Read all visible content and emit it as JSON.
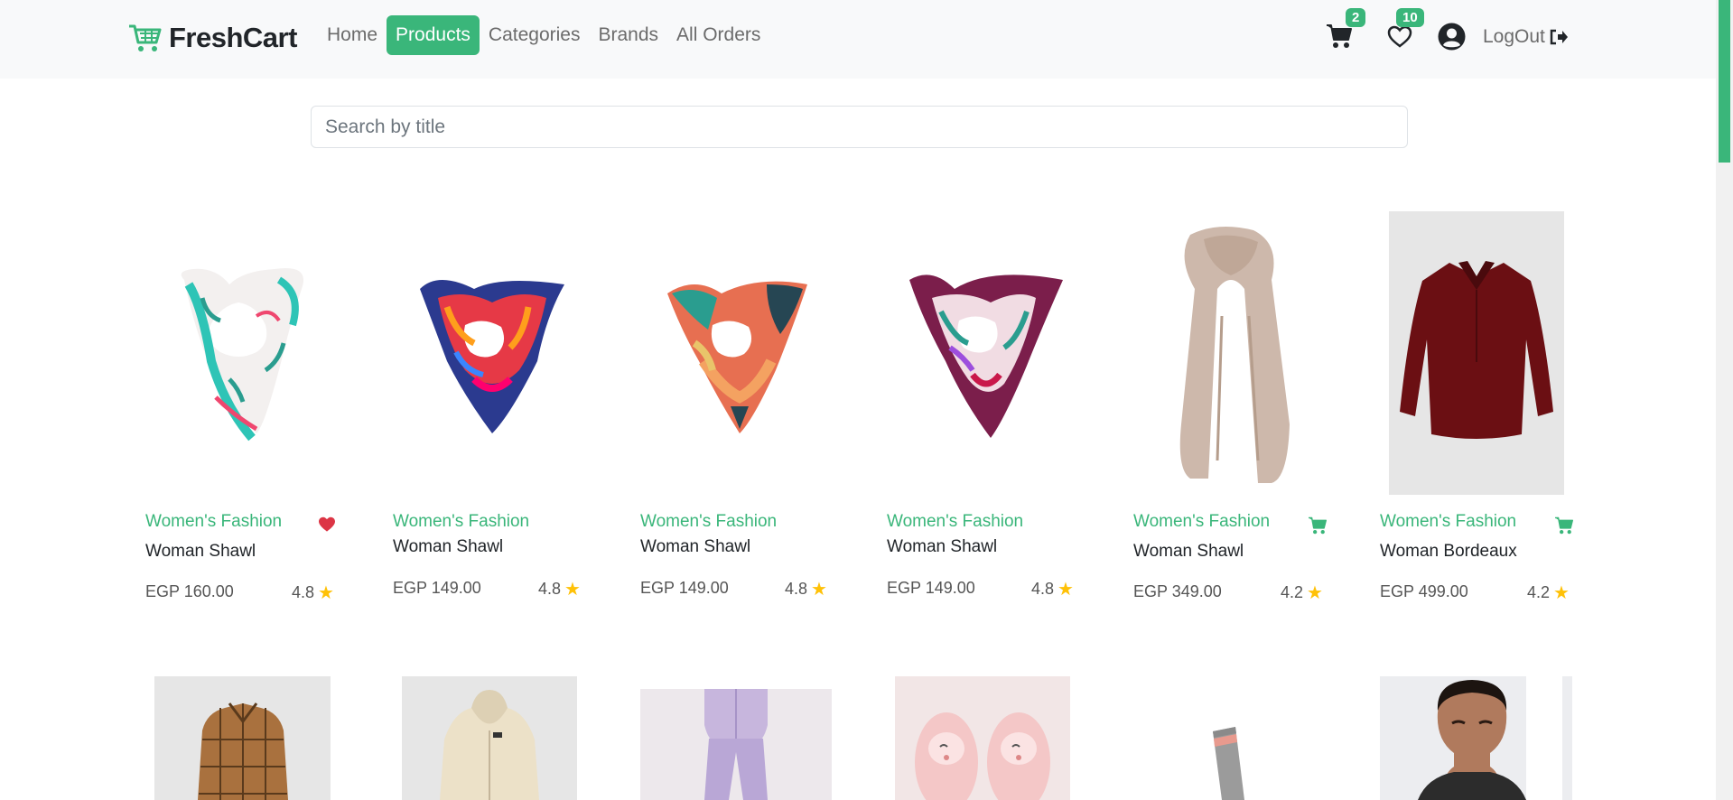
{
  "brand": {
    "name": "FreshCart"
  },
  "nav": {
    "links": [
      {
        "label": "Home",
        "active": false
      },
      {
        "label": "Products",
        "active": true
      },
      {
        "label": "Categories",
        "active": false
      },
      {
        "label": "Brands",
        "active": false
      },
      {
        "label": "All Orders",
        "active": false
      }
    ],
    "cart_count": "2",
    "wishlist_count": "10",
    "logout_label": "LogOut"
  },
  "search": {
    "placeholder": "Search by title",
    "value": ""
  },
  "colors": {
    "accent": "#3ab67a",
    "star": "#ffc107",
    "heart": "#dc3545"
  },
  "products": [
    {
      "category": "Women's Fashion",
      "title": "Woman Shawl",
      "price": "EGP 160.00",
      "rating": "4.8",
      "action_icon": "heart-filled-icon"
    },
    {
      "category": "Women's Fashion",
      "title": "Woman Shawl",
      "price": "EGP 149.00",
      "rating": "4.8",
      "action_icon": ""
    },
    {
      "category": "Women's Fashion",
      "title": "Woman Shawl",
      "price": "EGP 149.00",
      "rating": "4.8",
      "action_icon": ""
    },
    {
      "category": "Women's Fashion",
      "title": "Woman Shawl",
      "price": "EGP 149.00",
      "rating": "4.8",
      "action_icon": ""
    },
    {
      "category": "Women's Fashion",
      "title": "Woman Shawl",
      "price": "EGP 349.00",
      "rating": "4.2",
      "action_icon": "cart-icon"
    },
    {
      "category": "Women's Fashion",
      "title": "Woman Bordeaux",
      "price": "EGP 499.00",
      "rating": "4.2",
      "action_icon": "cart-icon"
    }
  ]
}
